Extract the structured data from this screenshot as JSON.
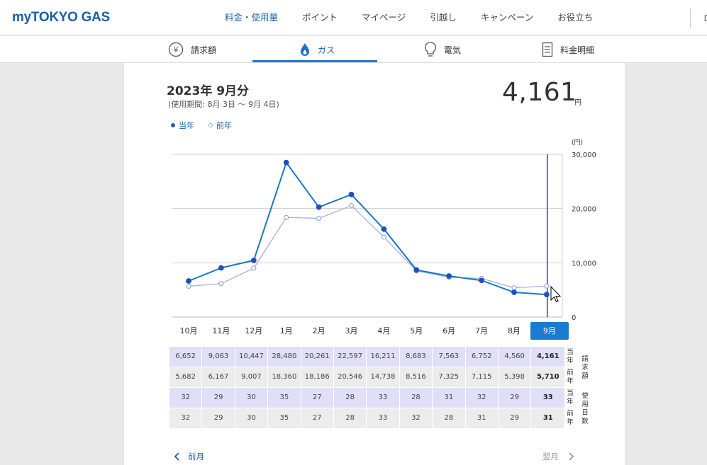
{
  "header": {
    "logo_prefix": "my",
    "logo_main": "TOKYO GAS",
    "nav": [
      "料金・使用量",
      "ポイント",
      "マイページ",
      "引越し",
      "キャンペーン",
      "お役立ち"
    ],
    "right_label": "ロ"
  },
  "tabs": [
    {
      "label": "請求額",
      "icon": "yen-icon"
    },
    {
      "label": "ガス",
      "icon": "gas-flame-icon"
    },
    {
      "label": "電気",
      "icon": "lightbulb-icon"
    },
    {
      "label": "料金明細",
      "icon": "statement-icon"
    }
  ],
  "summary": {
    "period_title": "2023年 9月分",
    "period_range": "(使用期間: 8月 3日 〜 9月 4日)",
    "amount": "4,161",
    "amount_unit": "円"
  },
  "legend": {
    "current": "当年",
    "previous": "前年",
    "current_color": "#1a5fc8",
    "previous_color": "#9da6e0"
  },
  "chart_data": {
    "type": "line",
    "x": [
      "10月",
      "11月",
      "12月",
      "1月",
      "2月",
      "3月",
      "4月",
      "5月",
      "6月",
      "7月",
      "8月",
      "9月"
    ],
    "series": [
      {
        "name": "当年",
        "values": [
          6652,
          9063,
          10447,
          28480,
          20261,
          22597,
          16211,
          8683,
          7563,
          6752,
          4560,
          4161
        ]
      },
      {
        "name": "前年",
        "values": [
          5682,
          6167,
          9007,
          18360,
          18186,
          20546,
          14738,
          8516,
          7325,
          7115,
          5398,
          5710
        ]
      }
    ],
    "ylabel": "(円)",
    "yticks": [
      "30,000",
      "20,000",
      "10,000",
      "0"
    ],
    "ylim": [
      0,
      30000
    ],
    "grid": true,
    "selected": "9月"
  },
  "table": {
    "billing_current": [
      "6,652",
      "9,063",
      "10,447",
      "28,480",
      "20,261",
      "22,597",
      "16,211",
      "8,683",
      "7,563",
      "6,752",
      "4,560",
      "4,161"
    ],
    "billing_previous": [
      "5,682",
      "6,167",
      "9,007",
      "18,360",
      "18,186",
      "20,546",
      "14,738",
      "8,516",
      "7,325",
      "7,115",
      "5,398",
      "5,710"
    ],
    "days_current": [
      "32",
      "29",
      "30",
      "35",
      "27",
      "28",
      "33",
      "28",
      "31",
      "32",
      "29",
      "33"
    ],
    "days_previous": [
      "32",
      "29",
      "30",
      "35",
      "27",
      "28",
      "33",
      "32",
      "28",
      "31",
      "29",
      "31"
    ],
    "label_current": "当年",
    "label_previous": "前年",
    "label_billing": "請求額",
    "label_days": "使用日数"
  },
  "pager": {
    "prev": "前月",
    "next": "翌月"
  }
}
